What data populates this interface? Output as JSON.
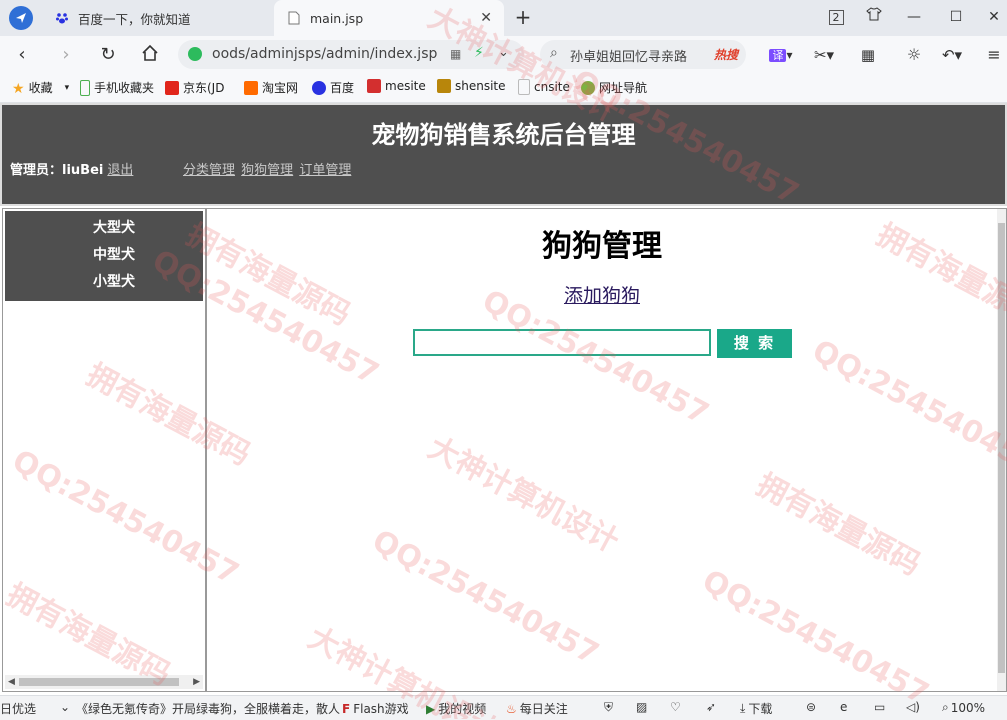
{
  "browser": {
    "tabs": [
      {
        "label": "百度一下，你就知道"
      },
      {
        "label": "main.jsp"
      }
    ],
    "window_badge": "2",
    "address": "oods/adminjsps/admin/index.jsp",
    "search_text": "孙卓姐姐回忆寻亲路",
    "search_badge": "热搜",
    "translate_label": "译",
    "bookmarks": [
      {
        "label": "收藏",
        "icon": "star-icon",
        "color": "#f5a623"
      },
      {
        "label": "手机收藏夹",
        "icon": "phone-icon",
        "color": "#4caf50"
      },
      {
        "label": "京东(JD",
        "icon": "jd-icon",
        "color": "#e1251b"
      },
      {
        "label": "淘宝网",
        "icon": "taobao-icon",
        "color": "#ff6a00"
      },
      {
        "label": "百度",
        "icon": "baidu-icon",
        "color": "#2932e1"
      },
      {
        "label": "mesite",
        "icon": "mesite-icon",
        "color": "#d32f2f"
      },
      {
        "label": "shensite",
        "icon": "shensite-icon",
        "color": "#b8860b"
      },
      {
        "label": "cnsite",
        "icon": "page-icon",
        "color": "#cccccc"
      },
      {
        "label": "网址导航",
        "icon": "nav-icon",
        "color": "#7cb342"
      }
    ]
  },
  "header": {
    "title": "宠物狗销售系统后台管理",
    "admin_label": "管理员：liuBei",
    "logout": "退出",
    "nav": [
      "分类管理",
      "狗狗管理",
      "订单管理"
    ]
  },
  "sidebar": {
    "categories": [
      "大型犬",
      "中型犬",
      "小型犬"
    ]
  },
  "main": {
    "heading": "狗狗管理",
    "add_link": "添加狗狗",
    "search_value": "",
    "search_button": "搜 索"
  },
  "statusbar": {
    "left_text": "日优选",
    "news": "《绿色无氪传奇》开局绿毒狗，全服横着走，散人",
    "flash": "Flash游戏",
    "video": "我的视频",
    "daily": "每日关注",
    "download": "下载",
    "zoom": "100%"
  },
  "watermark": {
    "texts": [
      "拥有海量源码",
      "QQ:254540457",
      "大神计算机设计"
    ]
  },
  "colors": {
    "header_bg": "#4f4f4f",
    "accent": "#1aa889"
  }
}
